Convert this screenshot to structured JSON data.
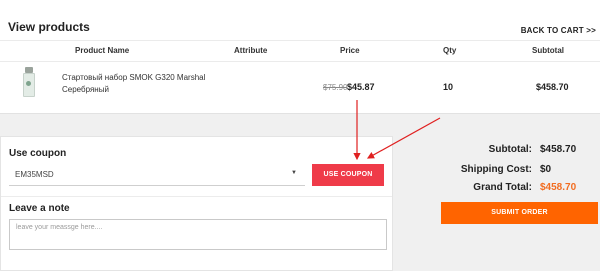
{
  "products": {
    "title": "View products",
    "back_link": "BACK TO CART >>",
    "columns": [
      "Product Name",
      "Attribute",
      "Price",
      "Qty",
      "Subtotal"
    ],
    "items": [
      {
        "image_icon": "vape-kit-product-image",
        "name": "Стартовый набор SMOK G320 Marshal Серебряный",
        "attribute": "",
        "price_old": "$75.90",
        "price": "$45.87",
        "qty": "10",
        "subtotal": "$458.70"
      }
    ]
  },
  "coupon": {
    "title": "Use coupon",
    "selected": "EM35MSD",
    "button": "USE COUPON"
  },
  "note": {
    "title": "Leave a note",
    "placeholder": "leave your meassge here...."
  },
  "totals": {
    "subtotal_label": "Subtotal:",
    "subtotal_value": "$458.70",
    "shipping_label": "Shipping Cost:",
    "shipping_value": "$0",
    "grand_label": "Grand Total:",
    "grand_value": "$458.70"
  },
  "submit_button": "SUBMIT ORDER",
  "colors": {
    "coupon_button": "#ef3b49",
    "submit_button": "#ff6400",
    "grand_total": "#f26d21",
    "annotation_arrow": "#e02020"
  }
}
